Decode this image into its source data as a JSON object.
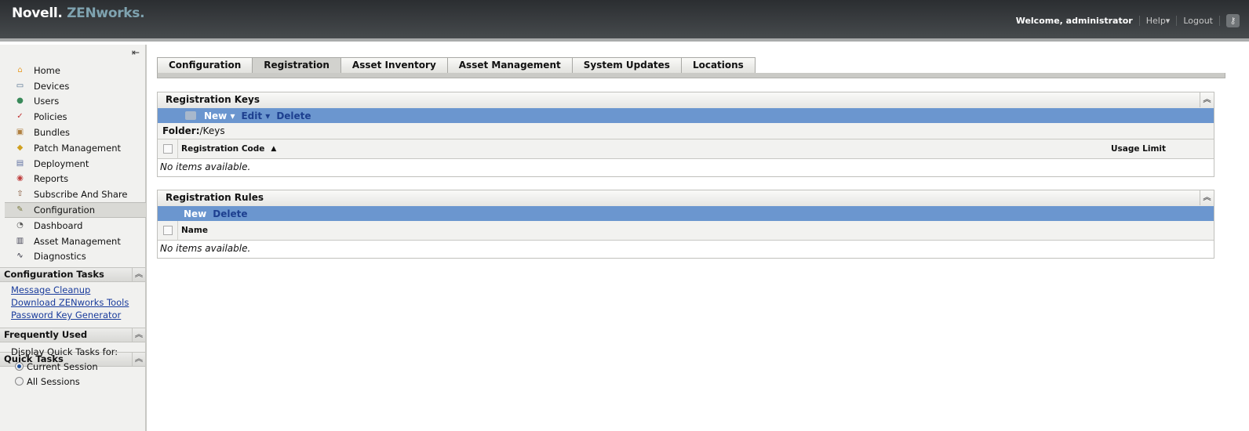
{
  "header": {
    "logo_novell": "Novell.",
    "logo_zen": "ZENworks.",
    "welcome": "Welcome, administrator",
    "help": "Help▾",
    "logout": "Logout"
  },
  "sidebar": {
    "nav": [
      {
        "label": "Home",
        "icon": "home-icon",
        "glyph": "⌂",
        "color": "#e8a030"
      },
      {
        "label": "Devices",
        "icon": "monitor-icon",
        "glyph": "▭",
        "color": "#4a6a8a"
      },
      {
        "label": "Users",
        "icon": "users-icon",
        "glyph": "●",
        "color": "#3a8a5a"
      },
      {
        "label": "Policies",
        "icon": "policy-icon",
        "glyph": "✓",
        "color": "#c03030"
      },
      {
        "label": "Bundles",
        "icon": "bundle-icon",
        "glyph": "▣",
        "color": "#b08040"
      },
      {
        "label": "Patch Management",
        "icon": "shield-icon",
        "glyph": "◆",
        "color": "#d0a020"
      },
      {
        "label": "Deployment",
        "icon": "deployment-icon",
        "glyph": "▤",
        "color": "#6070a0"
      },
      {
        "label": "Reports",
        "icon": "reports-icon",
        "glyph": "◉",
        "color": "#c04040"
      },
      {
        "label": "Subscribe And Share",
        "icon": "subscribe-icon",
        "glyph": "⇧",
        "color": "#805030"
      },
      {
        "label": "Configuration",
        "icon": "wrench-icon",
        "glyph": "✎",
        "color": "#7a7a40"
      },
      {
        "label": "Dashboard",
        "icon": "dashboard-icon",
        "glyph": "◔",
        "color": "#555"
      },
      {
        "label": "Asset Management",
        "icon": "asset-icon",
        "glyph": "▥",
        "color": "#445"
      },
      {
        "label": "Diagnostics",
        "icon": "diagnostics-icon",
        "glyph": "∿",
        "color": "#223"
      }
    ],
    "config_tasks": {
      "title": "Configuration Tasks",
      "links": [
        "Message Cleanup",
        "Download ZENworks Tools",
        "Password Key Generator"
      ]
    },
    "frequently_used": {
      "title": "Frequently Used"
    },
    "quick_tasks": {
      "title": "Quick Tasks",
      "label": "Display Quick Tasks for:",
      "options": [
        "Current Session",
        "All Sessions"
      ],
      "selected": "Current Session"
    }
  },
  "tabs": [
    "Configuration",
    "Registration",
    "Asset Inventory",
    "Asset Management",
    "System Updates",
    "Locations"
  ],
  "keys_panel": {
    "title": "Registration Keys",
    "new": "New ▾",
    "edit": "Edit ▾",
    "delete": "Delete",
    "folder_label": "Folder:",
    "folder": "/Keys",
    "col_code": "Registration Code",
    "col_limit": "Usage Limit",
    "empty": "No items available."
  },
  "rules_panel": {
    "title": "Registration Rules",
    "new": "New",
    "delete": "Delete",
    "col_name": "Name",
    "empty": "No items available."
  }
}
